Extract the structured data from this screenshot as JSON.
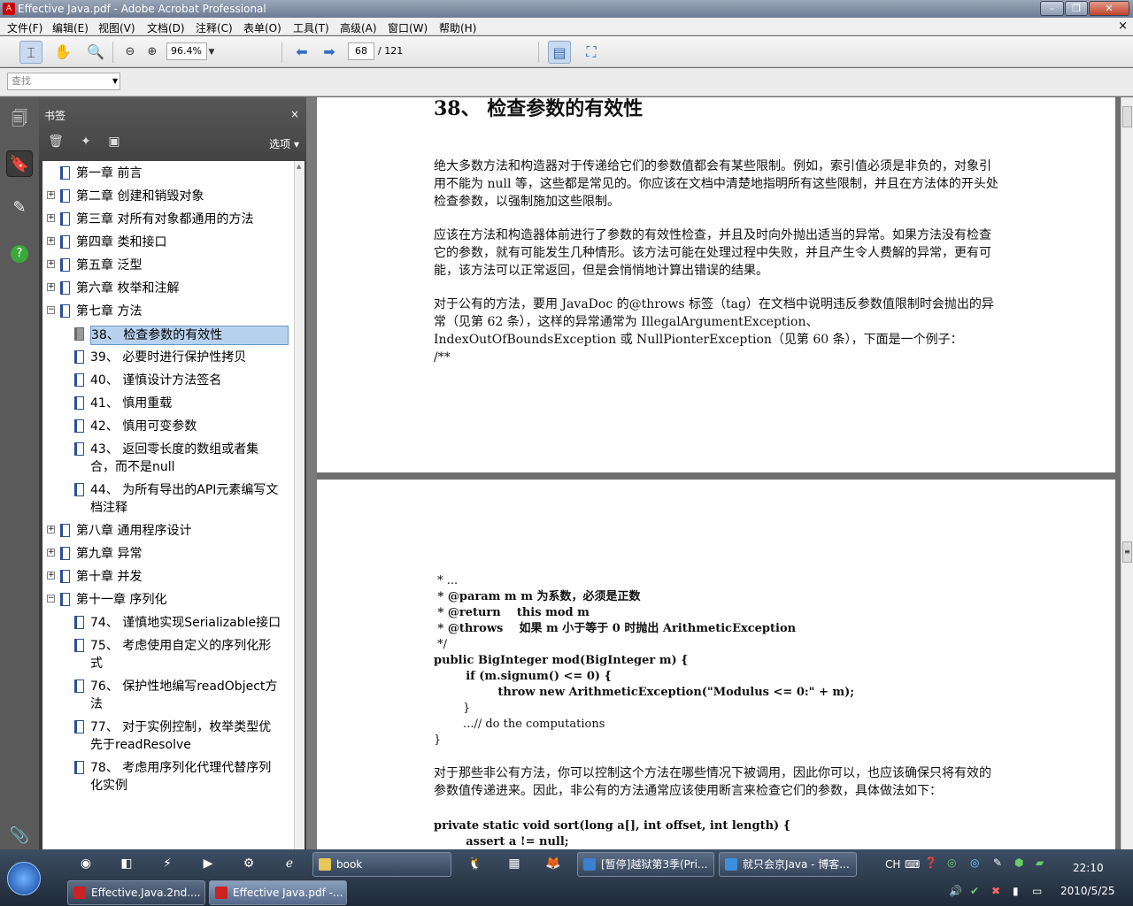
{
  "window": {
    "title": "Effective Java.pdf - Adobe Acrobat Professional"
  },
  "menu": [
    "文件(F)",
    "编辑(E)",
    "视图(V)",
    "文档(D)",
    "注释(C)",
    "表单(O)",
    "工具(T)",
    "高级(A)",
    "窗口(W)",
    "帮助(H)"
  ],
  "toolbar": {
    "zoom": "96.4%",
    "page": "68",
    "page_total": "/ 121"
  },
  "find": {
    "placeholder": "查找"
  },
  "panel": {
    "title": "书签",
    "close": "×",
    "options": "选项 ▾"
  },
  "bookmarks": [
    {
      "level": 0,
      "expand": "",
      "label": "第一章 前言"
    },
    {
      "level": 0,
      "expand": "+",
      "label": "第二章 创建和销毁对象"
    },
    {
      "level": 0,
      "expand": "+",
      "label": "第三章 对所有对象都通用的方法"
    },
    {
      "level": 0,
      "expand": "+",
      "label": "第四章 类和接口"
    },
    {
      "level": 0,
      "expand": "+",
      "label": "第五章 泛型"
    },
    {
      "level": 0,
      "expand": "+",
      "label": "第六章 枚举和注解"
    },
    {
      "level": 0,
      "expand": "−",
      "label": "第七章 方法"
    },
    {
      "level": 1,
      "selected": true,
      "label": "38、 检查参数的有效性"
    },
    {
      "level": 1,
      "label": "39、 必要时进行保护性拷贝"
    },
    {
      "level": 1,
      "label": "40、 谨慎设计方法签名"
    },
    {
      "level": 1,
      "label": "41、 慎用重载"
    },
    {
      "level": 1,
      "label": "42、 慎用可变参数"
    },
    {
      "level": 1,
      "label": "43、 返回零长度的数组或者集",
      "label2": "合，而不是null"
    },
    {
      "level": 1,
      "label": "44、 为所有导出的API元素编写文",
      "label2": "档注释"
    },
    {
      "level": 0,
      "expand": "+",
      "label": "第八章 通用程序设计"
    },
    {
      "level": 0,
      "expand": "+",
      "label": "第九章 异常"
    },
    {
      "level": 0,
      "expand": "+",
      "label": "第十章 并发"
    },
    {
      "level": 0,
      "expand": "−",
      "label": "第十一章 序列化"
    },
    {
      "level": 1,
      "label": "74、 谨慎地实现Serializable接口"
    },
    {
      "level": 1,
      "label": "75、 考虑使用自定义的序列化形",
      "label2": "式"
    },
    {
      "level": 1,
      "label": "76、 保护性地编写readObject方",
      "label2": "法"
    },
    {
      "level": 1,
      "label": "77、 对于实例控制，枚举类型优",
      "label2": "先于readResolve"
    },
    {
      "level": 1,
      "label": "78、 考虑用序列化代理代替序列",
      "label2": "化实例"
    }
  ],
  "doc": {
    "heading": "38、  检查参数的有效性",
    "p1": "绝大多数方法和构造器对于传递给它们的参数值都会有某些限制。例如，索引值必须是非负的，对象引用不能为 null 等，这些都是常见的。你应该在文档中清楚地指明所有这些限制，并且在方法体的开头处检查参数，以强制施加这些限制。",
    "p2": "应该在方法和构造器体前进行了参数的有效性检查，并且及时向外抛出适当的异常。如果方法没有检查它的参数，就有可能发生几种情形。该方法可能在处理过程中失败，并且产生令人费解的异常，更有可能，该方法可以正常返回，但是会悄悄地计算出错误的结果。",
    "p3": "对于公有的方法，要用 JavaDoc 的@throws 标签（tag）在文档中说明违反参数值限制时会抛出的异常（见第 62 条），这样的异常通常为 IllegalArgumentException、IndexOutOfBoundsException 或 NullPionterException（见第 60 条），下面是一个例子：",
    "p3b": "/**",
    "code": [
      " * ...",
      " * @param m m 为系数，必须是正数",
      " * @return    this mod m",
      " * @throws    如果 m 小于等于 0 时抛出 ArithmeticException",
      " */",
      "public BigInteger mod(BigInteger m) {",
      "        if (m.signum() <= 0) {",
      "                throw new ArithmeticException(\"Modulus <= 0:\" + m);",
      "        }",
      "        ...// do the computations",
      "}"
    ],
    "p4": "对于那些非公有方法，你可以控制这个方法在哪些情况下被调用，因此你可以，也应该确保只将有效的参数值传递进来。因此，非公有的方法通常应该使用断言来检查它们的参数，具体做法如下：",
    "code2": [
      "private static void sort(long a[], int offset, int length) {",
      "        assert a != null;"
    ]
  },
  "taskbar": {
    "row1": [
      "book",
      "[暂停]越狱第3季(Pri...",
      "就只会京Java - 博客..."
    ],
    "row2": [
      "Effective.Java.2nd....",
      "Effective Java.pdf -..."
    ],
    "lang": "CH",
    "time": "22:10",
    "date": "2010/5/25"
  }
}
